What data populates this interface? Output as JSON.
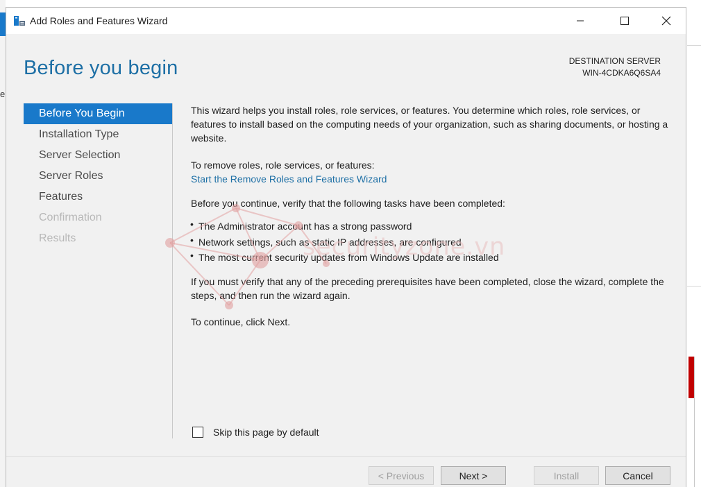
{
  "window": {
    "title": "Add Roles and Features Wizard"
  },
  "header": {
    "page_title": "Before you begin",
    "destination_label": "DESTINATION SERVER",
    "destination_server": "WIN-4CDKA6Q6SA4"
  },
  "nav": {
    "items": [
      {
        "label": "Before You Begin",
        "state": "active"
      },
      {
        "label": "Installation Type",
        "state": "enabled"
      },
      {
        "label": "Server Selection",
        "state": "enabled"
      },
      {
        "label": "Server Roles",
        "state": "enabled"
      },
      {
        "label": "Features",
        "state": "enabled"
      },
      {
        "label": "Confirmation",
        "state": "disabled"
      },
      {
        "label": "Results",
        "state": "disabled"
      }
    ]
  },
  "content": {
    "intro": "This wizard helps you install roles, role services, or features. You determine which roles, role services, or features to install based on the computing needs of your organization, such as sharing documents, or hosting a website.",
    "remove_prompt": "To remove roles, role services, or features:",
    "remove_link": "Start the Remove Roles and Features Wizard",
    "verify_prompt": "Before you continue, verify that the following tasks have been completed:",
    "bullets": [
      "The Administrator account has a strong password",
      "Network settings, such as static IP addresses, are configured",
      "The most current security updates from Windows Update are installed"
    ],
    "prereq_note": "If you must verify that any of the preceding prerequisites have been completed, close the wizard, complete the steps, and then run the wizard again.",
    "continue_note": "To continue, click Next."
  },
  "skip": {
    "label": "Skip this page by default",
    "checked": false
  },
  "buttons": {
    "previous": "< Previous",
    "next": "Next >",
    "install": "Install",
    "cancel": "Cancel"
  },
  "watermark": {
    "text": "securityzone.vn"
  },
  "background": {
    "left_char": "e"
  },
  "colors": {
    "accent": "#1979ca",
    "title_blue": "#1d6fa5",
    "link": "#1d6fa5"
  }
}
